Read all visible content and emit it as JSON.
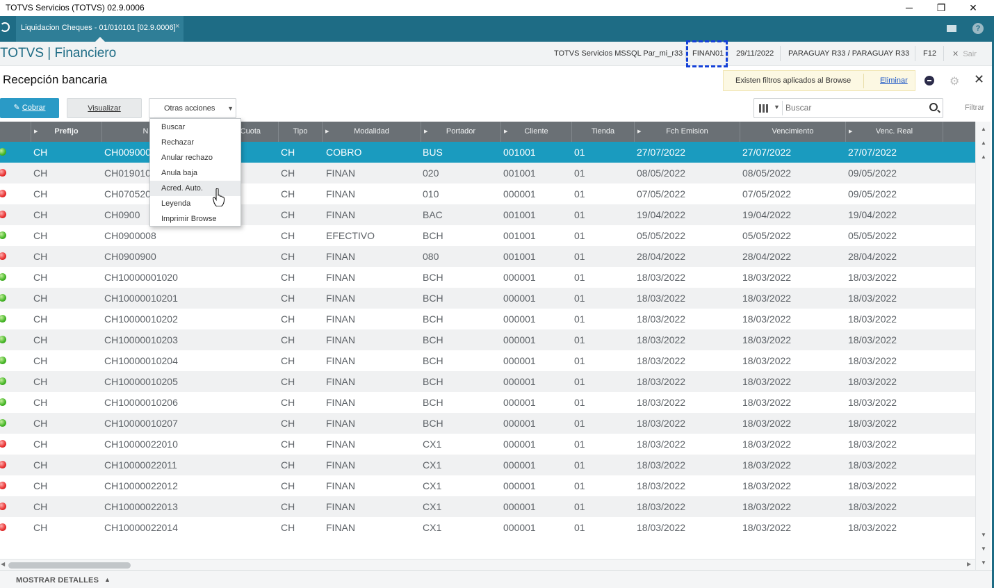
{
  "window": {
    "title": "TOTVS Servicios (TOTVS) 02.9.0006",
    "minimize": "─",
    "restore": "❐",
    "close": "✕"
  },
  "tabs": [
    {
      "label": "Liquidacion Cheques - 01/010101 [02.9.0006]",
      "close": "×"
    }
  ],
  "app": {
    "title": "TOTVS | Financiero",
    "environment": "TOTVS Servicios MSSQL Par_mi_r33",
    "user": "FINAN01",
    "date": "29/11/2022",
    "company": "PARAGUAY R33 / PARAGUAY R33",
    "shortcut": "F12",
    "exit_label": "Sair"
  },
  "page": {
    "title": "Recepción bancaria",
    "filter_notice": "Existen filtros aplicados al Browse",
    "filter_remove": "Eliminar",
    "close_icon": "✕",
    "gear_icon": "⚙"
  },
  "toolbar": {
    "cobrar": "Cobrar",
    "visualizar": "Visualizar",
    "otras_acciones": "Otras acciones",
    "search_placeholder": "Buscar",
    "filtrar": "Filtrar"
  },
  "menu": {
    "items": [
      "Buscar",
      "Rechazar",
      "Anular rechazo",
      "Anula baja",
      "Acred. Auto.",
      "Leyenda",
      "Imprimir Browse"
    ],
    "hovered": "Acred. Auto."
  },
  "grid": {
    "headers": [
      "Prefijo",
      "N",
      "Cuota",
      "Tipo",
      "Modalidad",
      "Portador",
      "Cliente",
      "Tienda",
      "Fch Emision",
      "Vencimiento",
      "Venc. Real"
    ],
    "rows": [
      {
        "status": "green",
        "prefijo": "CH",
        "numero": "CH0090009",
        "tipo": "CH",
        "modalidad": "COBRO",
        "portador": "BUS",
        "cliente": "001001",
        "tienda": "01",
        "emision": "27/07/2022",
        "vencimiento": "27/07/2022",
        "venc_real": "27/07/2022"
      },
      {
        "status": "red",
        "prefijo": "CH",
        "numero": "CH019010",
        "tipo": "CH",
        "modalidad": "FINAN",
        "portador": "020",
        "cliente": "001001",
        "tienda": "01",
        "emision": "08/05/2022",
        "vencimiento": "08/05/2022",
        "venc_real": "09/05/2022"
      },
      {
        "status": "red",
        "prefijo": "CH",
        "numero": "CH070520",
        "tipo": "CH",
        "modalidad": "FINAN",
        "portador": "010",
        "cliente": "000001",
        "tienda": "01",
        "emision": "07/05/2022",
        "vencimiento": "07/05/2022",
        "venc_real": "09/05/2022"
      },
      {
        "status": "red",
        "prefijo": "CH",
        "numero": "CH0900",
        "tipo": "CH",
        "modalidad": "FINAN",
        "portador": "BAC",
        "cliente": "001001",
        "tienda": "01",
        "emision": "19/04/2022",
        "vencimiento": "19/04/2022",
        "venc_real": "19/04/2022"
      },
      {
        "status": "green",
        "prefijo": "CH",
        "numero": "CH0900008",
        "tipo": "CH",
        "modalidad": "EFECTIVO",
        "portador": "BCH",
        "cliente": "001001",
        "tienda": "01",
        "emision": "05/05/2022",
        "vencimiento": "05/05/2022",
        "venc_real": "05/05/2022"
      },
      {
        "status": "red",
        "prefijo": "CH",
        "numero": "CH0900900",
        "tipo": "CH",
        "modalidad": "FINAN",
        "portador": "080",
        "cliente": "001001",
        "tienda": "01",
        "emision": "28/04/2022",
        "vencimiento": "28/04/2022",
        "venc_real": "28/04/2022"
      },
      {
        "status": "green",
        "prefijo": "CH",
        "numero": "CH10000001020",
        "tipo": "CH",
        "modalidad": "FINAN",
        "portador": "BCH",
        "cliente": "000001",
        "tienda": "01",
        "emision": "18/03/2022",
        "vencimiento": "18/03/2022",
        "venc_real": "18/03/2022"
      },
      {
        "status": "green",
        "prefijo": "CH",
        "numero": "CH10000010201",
        "tipo": "CH",
        "modalidad": "FINAN",
        "portador": "BCH",
        "cliente": "000001",
        "tienda": "01",
        "emision": "18/03/2022",
        "vencimiento": "18/03/2022",
        "venc_real": "18/03/2022"
      },
      {
        "status": "green",
        "prefijo": "CH",
        "numero": "CH10000010202",
        "tipo": "CH",
        "modalidad": "FINAN",
        "portador": "BCH",
        "cliente": "000001",
        "tienda": "01",
        "emision": "18/03/2022",
        "vencimiento": "18/03/2022",
        "venc_real": "18/03/2022"
      },
      {
        "status": "green",
        "prefijo": "CH",
        "numero": "CH10000010203",
        "tipo": "CH",
        "modalidad": "FINAN",
        "portador": "BCH",
        "cliente": "000001",
        "tienda": "01",
        "emision": "18/03/2022",
        "vencimiento": "18/03/2022",
        "venc_real": "18/03/2022"
      },
      {
        "status": "green",
        "prefijo": "CH",
        "numero": "CH10000010204",
        "tipo": "CH",
        "modalidad": "FINAN",
        "portador": "BCH",
        "cliente": "000001",
        "tienda": "01",
        "emision": "18/03/2022",
        "vencimiento": "18/03/2022",
        "venc_real": "18/03/2022"
      },
      {
        "status": "green",
        "prefijo": "CH",
        "numero": "CH10000010205",
        "tipo": "CH",
        "modalidad": "FINAN",
        "portador": "BCH",
        "cliente": "000001",
        "tienda": "01",
        "emision": "18/03/2022",
        "vencimiento": "18/03/2022",
        "venc_real": "18/03/2022"
      },
      {
        "status": "green",
        "prefijo": "CH",
        "numero": "CH10000010206",
        "tipo": "CH",
        "modalidad": "FINAN",
        "portador": "BCH",
        "cliente": "000001",
        "tienda": "01",
        "emision": "18/03/2022",
        "vencimiento": "18/03/2022",
        "venc_real": "18/03/2022"
      },
      {
        "status": "green",
        "prefijo": "CH",
        "numero": "CH10000010207",
        "tipo": "CH",
        "modalidad": "FINAN",
        "portador": "BCH",
        "cliente": "000001",
        "tienda": "01",
        "emision": "18/03/2022",
        "vencimiento": "18/03/2022",
        "venc_real": "18/03/2022"
      },
      {
        "status": "red",
        "prefijo": "CH",
        "numero": "CH10000022010",
        "tipo": "CH",
        "modalidad": "FINAN",
        "portador": "CX1",
        "cliente": "000001",
        "tienda": "01",
        "emision": "18/03/2022",
        "vencimiento": "18/03/2022",
        "venc_real": "18/03/2022"
      },
      {
        "status": "red",
        "prefijo": "CH",
        "numero": "CH10000022011",
        "tipo": "CH",
        "modalidad": "FINAN",
        "portador": "CX1",
        "cliente": "000001",
        "tienda": "01",
        "emision": "18/03/2022",
        "vencimiento": "18/03/2022",
        "venc_real": "18/03/2022"
      },
      {
        "status": "red",
        "prefijo": "CH",
        "numero": "CH10000022012",
        "tipo": "CH",
        "modalidad": "FINAN",
        "portador": "CX1",
        "cliente": "000001",
        "tienda": "01",
        "emision": "18/03/2022",
        "vencimiento": "18/03/2022",
        "venc_real": "18/03/2022"
      },
      {
        "status": "red",
        "prefijo": "CH",
        "numero": "CH10000022013",
        "tipo": "CH",
        "modalidad": "FINAN",
        "portador": "CX1",
        "cliente": "000001",
        "tienda": "01",
        "emision": "18/03/2022",
        "vencimiento": "18/03/2022",
        "venc_real": "18/03/2022"
      },
      {
        "status": "red",
        "prefijo": "CH",
        "numero": "CH10000022014",
        "tipo": "CH",
        "modalidad": "FINAN",
        "portador": "CX1",
        "cliente": "000001",
        "tienda": "01",
        "emision": "18/03/2022",
        "vencimiento": "18/03/2022",
        "venc_real": "18/03/2022"
      }
    ],
    "selected_row": 0
  },
  "footer": {
    "details_label": "MOSTRAR DETALLES"
  },
  "colors": {
    "brand": "#1e6c85",
    "selected_row": "#1a9bbf",
    "primary_button": "#2a9ac6",
    "status_ok": "#44b526",
    "status_error": "#e83030"
  }
}
